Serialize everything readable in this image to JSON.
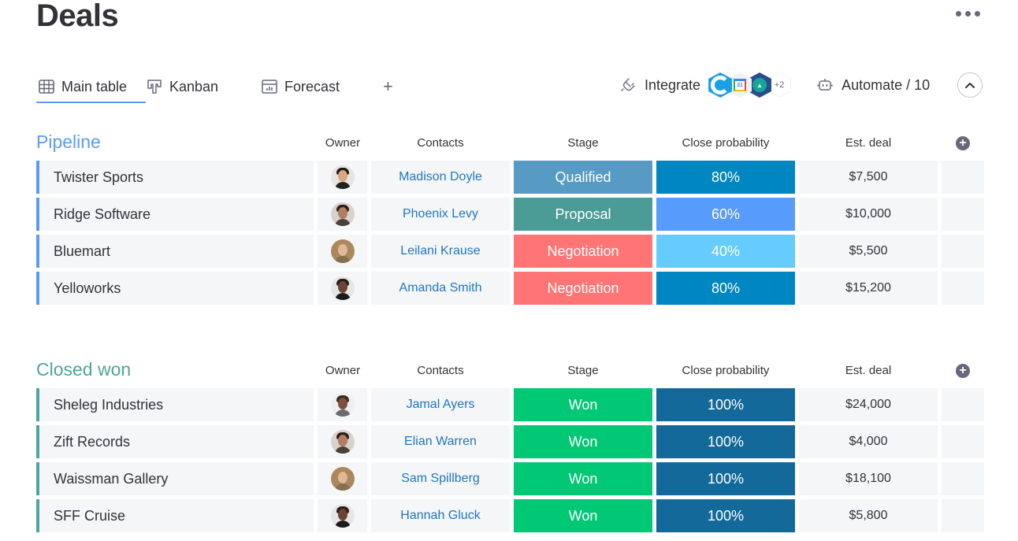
{
  "page": {
    "title": "Deals",
    "more_icon": "ellipsis-horizontal-icon"
  },
  "tabs": [
    {
      "label": "Main table",
      "icon": "table-icon",
      "active": true
    },
    {
      "label": "Kanban",
      "icon": "kanban-icon",
      "active": false
    },
    {
      "label": "Forecast",
      "icon": "chart-icon",
      "active": false
    }
  ],
  "add_tab_label": "+",
  "toolbar": {
    "integrate_label": "Integrate",
    "integrations": [
      "salesforce",
      "google-calendar",
      "zendesk"
    ],
    "integrations_more": "+2",
    "automate_label": "Automate / 10"
  },
  "columns": {
    "owner": "Owner",
    "contacts": "Contacts",
    "stage": "Stage",
    "probability": "Close probability",
    "deal": "Est. deal"
  },
  "colors": {
    "pipeline": "#5b9cf0",
    "closed_won": "#4ca59c",
    "link": "#1f76c2",
    "stage_qualified": "#579bc4",
    "stage_proposal": "#4b9c96",
    "stage_negotiation": "#ff7575",
    "stage_won": "#00c875",
    "prob_80": "#0086c0",
    "prob_60": "#579bfc",
    "prob_40": "#66ccff",
    "prob_100": "#13699a"
  },
  "groups": [
    {
      "title": "Pipeline",
      "rows": [
        {
          "name": "Twister Sports",
          "owner": "man-1",
          "contact": "Madison Doyle",
          "stage": "Qualified",
          "probability": "80%",
          "deal": "$7,500"
        },
        {
          "name": "Ridge Software",
          "owner": "woman-1",
          "contact": "Phoenix Levy",
          "stage": "Proposal",
          "probability": "60%",
          "deal": "$10,000"
        },
        {
          "name": "Bluemart",
          "owner": "woman-2",
          "contact": "Leilani Krause",
          "stage": "Negotiation",
          "probability": "40%",
          "deal": "$5,500"
        },
        {
          "name": "Yelloworks",
          "owner": "man-2",
          "contact": "Amanda Smith",
          "stage": "Negotiation",
          "probability": "80%",
          "deal": "$15,200"
        }
      ]
    },
    {
      "title": "Closed won",
      "rows": [
        {
          "name": "Sheleg Industries",
          "owner": "man-3",
          "contact": "Jamal Ayers",
          "stage": "Won",
          "probability": "100%",
          "deal": "$24,000"
        },
        {
          "name": "Zift Records",
          "owner": "woman-1",
          "contact": "Elian Warren",
          "stage": "Won",
          "probability": "100%",
          "deal": "$4,000"
        },
        {
          "name": "Waissman Gallery",
          "owner": "woman-2",
          "contact": "Sam Spillberg",
          "stage": "Won",
          "probability": "100%",
          "deal": "$18,100"
        },
        {
          "name": "SFF Cruise",
          "owner": "man-2",
          "contact": "Hannah Gluck",
          "stage": "Won",
          "probability": "100%",
          "deal": "$5,800"
        }
      ]
    }
  ]
}
